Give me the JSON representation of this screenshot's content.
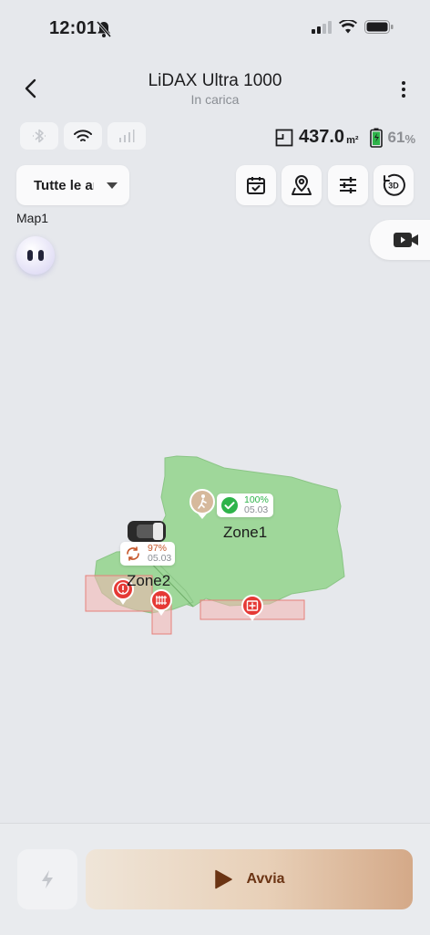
{
  "status_bar": {
    "time": "12:01"
  },
  "header": {
    "title": "LiDAX Ultra 1000",
    "subtitle": "In carica"
  },
  "connectivity": {
    "bluetooth": "bluetooth-icon",
    "wifi": "wifi-icon",
    "cellular": "cellular-icon"
  },
  "stats": {
    "area_value": "437.0",
    "area_unit": "m²",
    "battery_value": "61",
    "battery_unit": "%"
  },
  "map_selector": {
    "label": "Tutte le aree"
  },
  "toolbar": {
    "schedule": "calendar-check-icon",
    "location": "map-pin-icon",
    "settings": "sliders-icon",
    "view_3d": "3D"
  },
  "map": {
    "name": "Map1",
    "zones": [
      {
        "name": "Zone1",
        "progress": "100%",
        "date": "05.03"
      },
      {
        "name": "Zone2",
        "progress": "97%",
        "date": "05.03"
      }
    ]
  },
  "bottom": {
    "start_label": "Avvia"
  },
  "colors": {
    "lawn": "#9fd79a",
    "no_go": "#f4b5b2",
    "marker_red": "#e53935",
    "accent_brown": "#6b3414"
  }
}
